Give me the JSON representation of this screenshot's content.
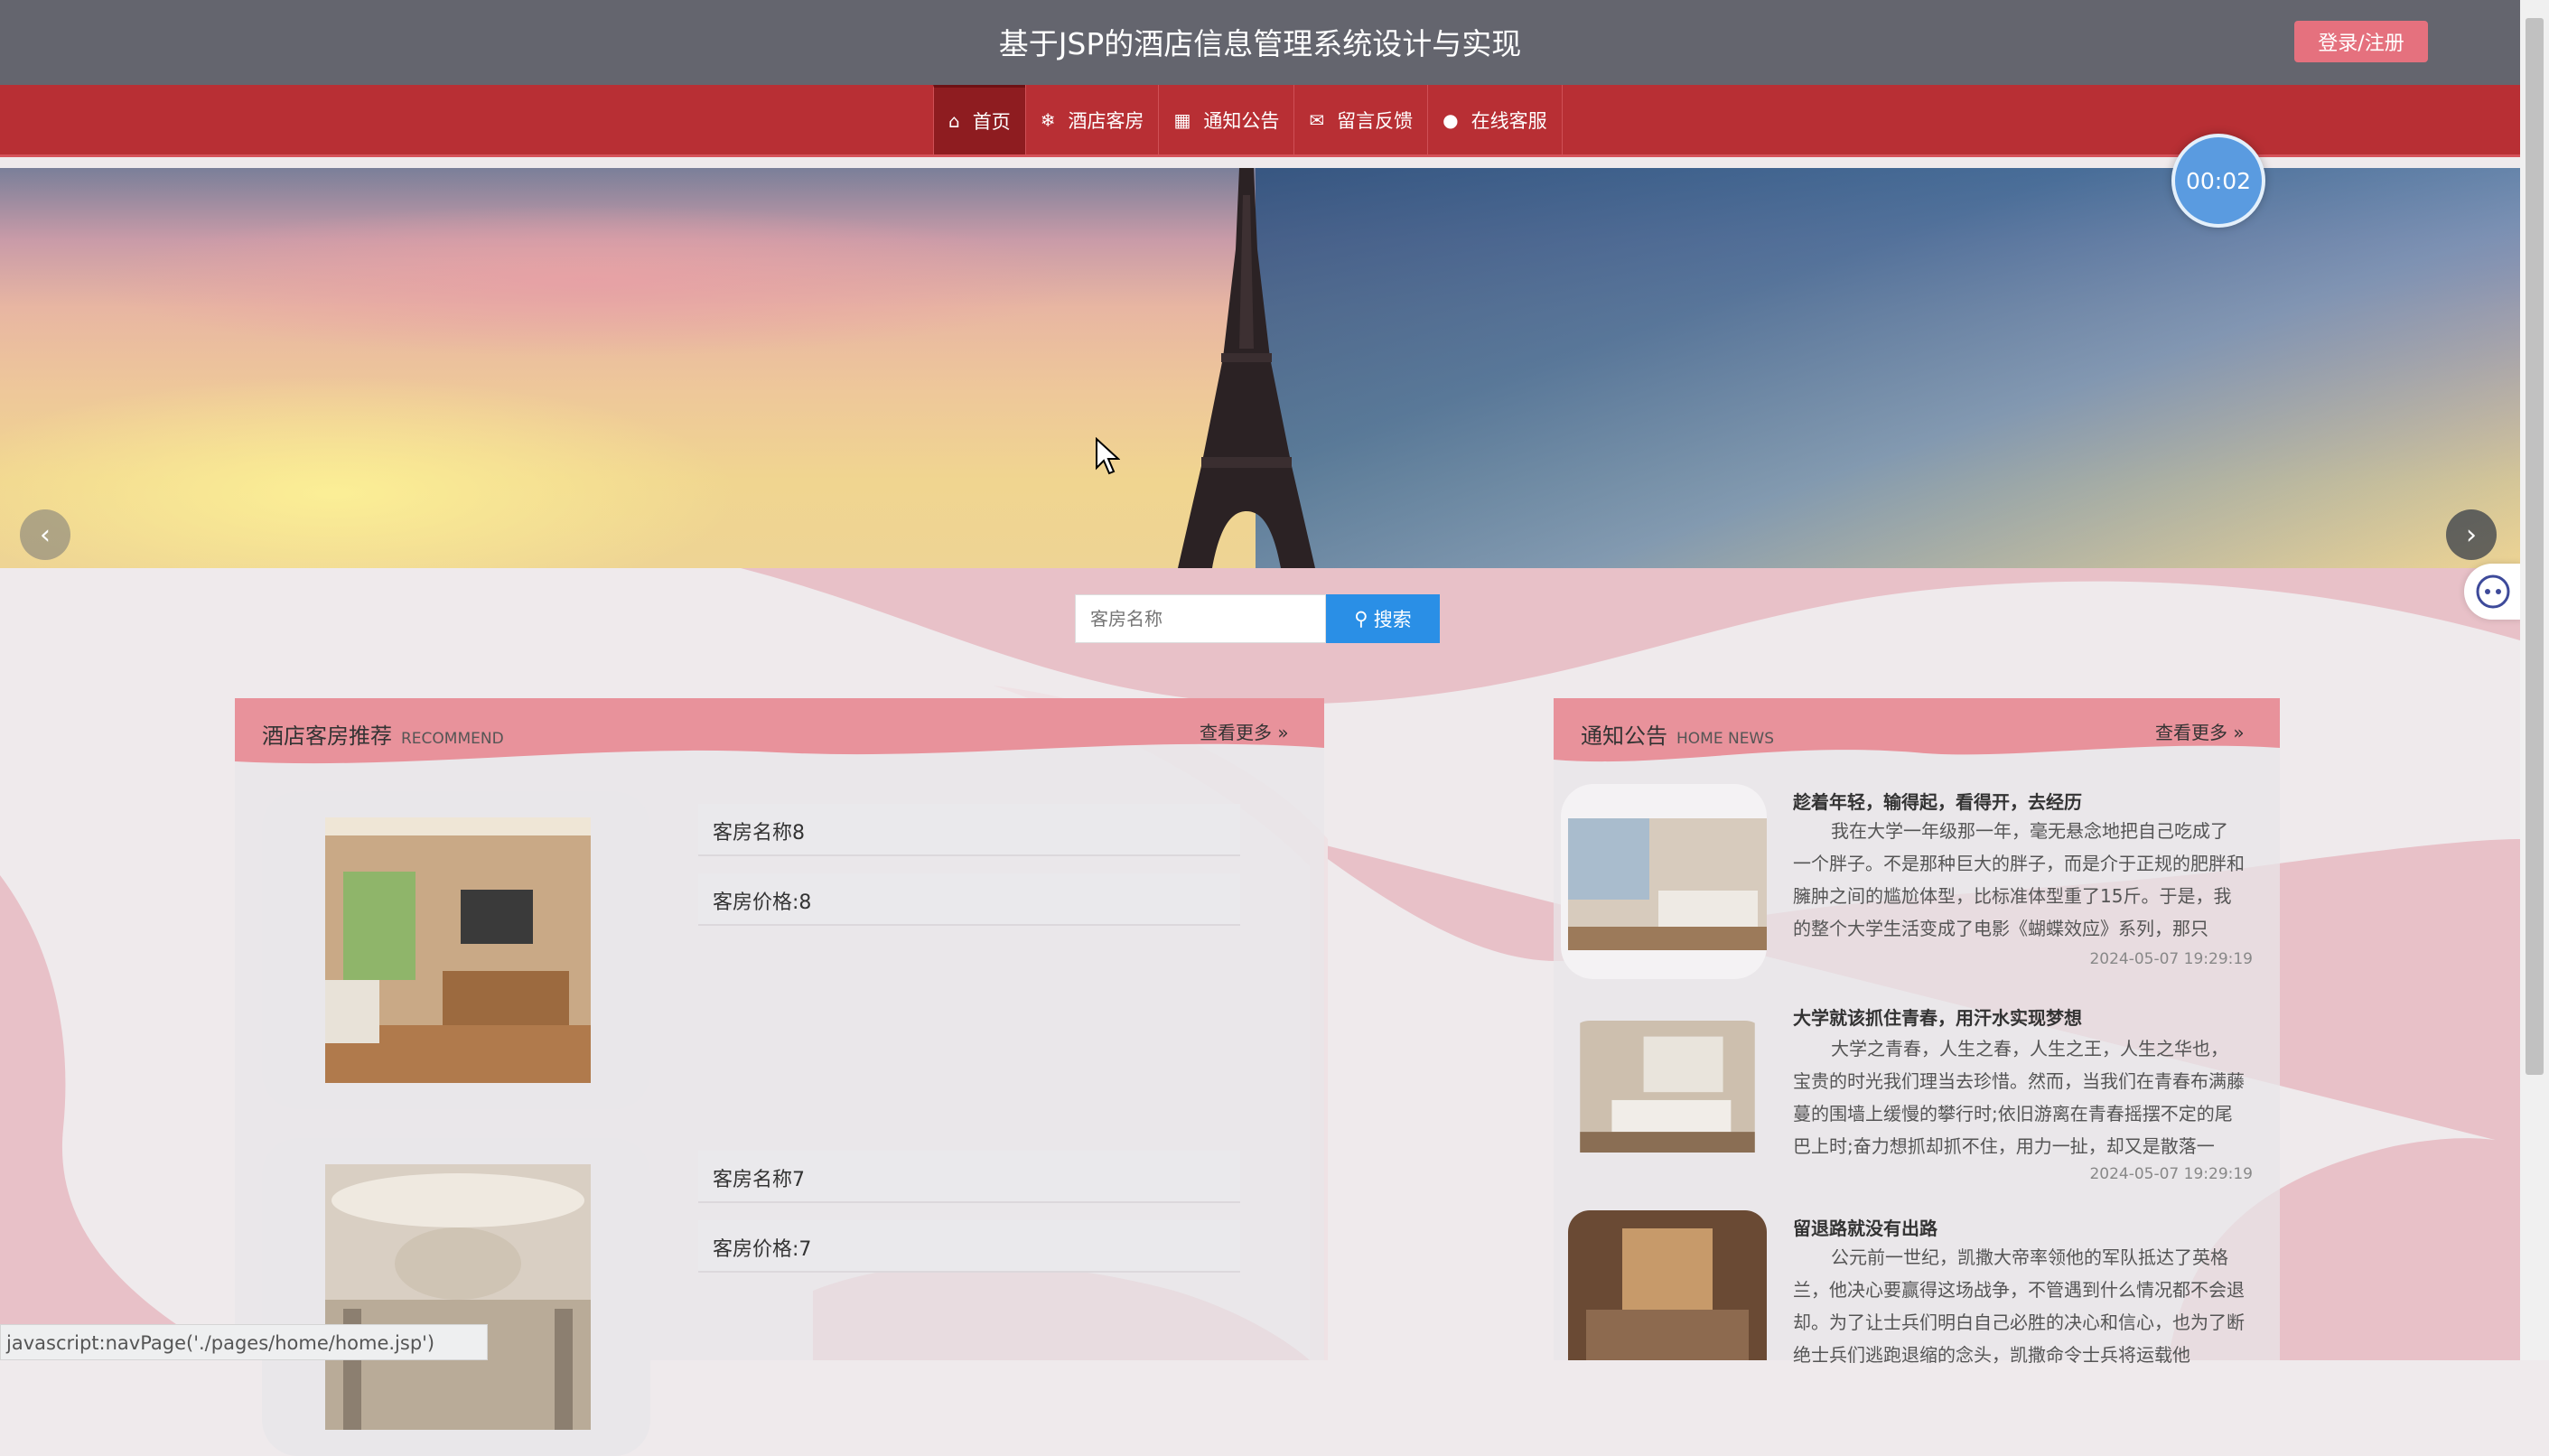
{
  "header": {
    "site_title": "基于JSP的酒店信息管理系统设计与实现",
    "login_label": "登录/注册"
  },
  "nav": {
    "items": [
      {
        "label": "首页",
        "icon": "home-icon",
        "active": true
      },
      {
        "label": "酒店客房",
        "icon": "snowflake-icon"
      },
      {
        "label": "通知公告",
        "icon": "calendar-icon"
      },
      {
        "label": "留言反馈",
        "icon": "mail-icon"
      },
      {
        "label": "在线客服",
        "icon": "chat-icon"
      }
    ]
  },
  "timer": {
    "value": "00:02"
  },
  "search": {
    "placeholder": "客房名称",
    "button_label": "搜索"
  },
  "recommend": {
    "title": "酒店客房推荐",
    "subtitle": "RECOMMEND",
    "more_label": "查看更多",
    "rooms": [
      {
        "name": "客房名称8",
        "price": "客房价格:8"
      },
      {
        "name": "客房名称7",
        "price": "客房价格:7"
      }
    ]
  },
  "news": {
    "title": "通知公告",
    "subtitle": "HOME NEWS",
    "more_label": "查看更多",
    "items": [
      {
        "title": "趁着年轻，输得起，看得开，去经历",
        "body": "我在大学一年级那一年，毫无悬念地把自己吃成了一个胖子。不是那种巨大的胖子，而是介于正规的肥胖和臃肿之间的尴尬体型，比标准体型重了15斤。于是，我的整个大学生活变成了电影《蝴蝶效应》系列，那只",
        "date": "2024-05-07 19:29:19"
      },
      {
        "title": "大学就该抓住青春，用汗水实现梦想",
        "body": "大学之青春，人生之春，人生之王，人生之华也，宝贵的时光我们理当去珍惜。然而，当我们在青春布满藤蔓的围墙上缓慢的攀行时;依旧游离在青春摇摆不定的尾巴上时;奋力想抓却抓不住，用力一扯，却又是散落一",
        "date": "2024-05-07 19:29:19"
      },
      {
        "title": "留退路就没有出路",
        "body": "公元前一世纪，凯撒大帝率领他的军队抵达了英格兰，他决心要赢得这场战争，不管遇到什么情况都不会退却。为了让士兵们明白自己必胜的决心和信心，也为了断绝士兵们逃跑退缩的念头，凯撒命令士兵将运载他",
        "date": ""
      }
    ]
  },
  "statusbar": {
    "text": "javascript:navPage('./pages/home/home.jsp')"
  },
  "colors": {
    "topbar": "#64656e",
    "navbar": "#b82f34",
    "accent_pink": "#e8929b",
    "search_blue": "#2a8fe6",
    "login_pink": "#e5717e"
  }
}
